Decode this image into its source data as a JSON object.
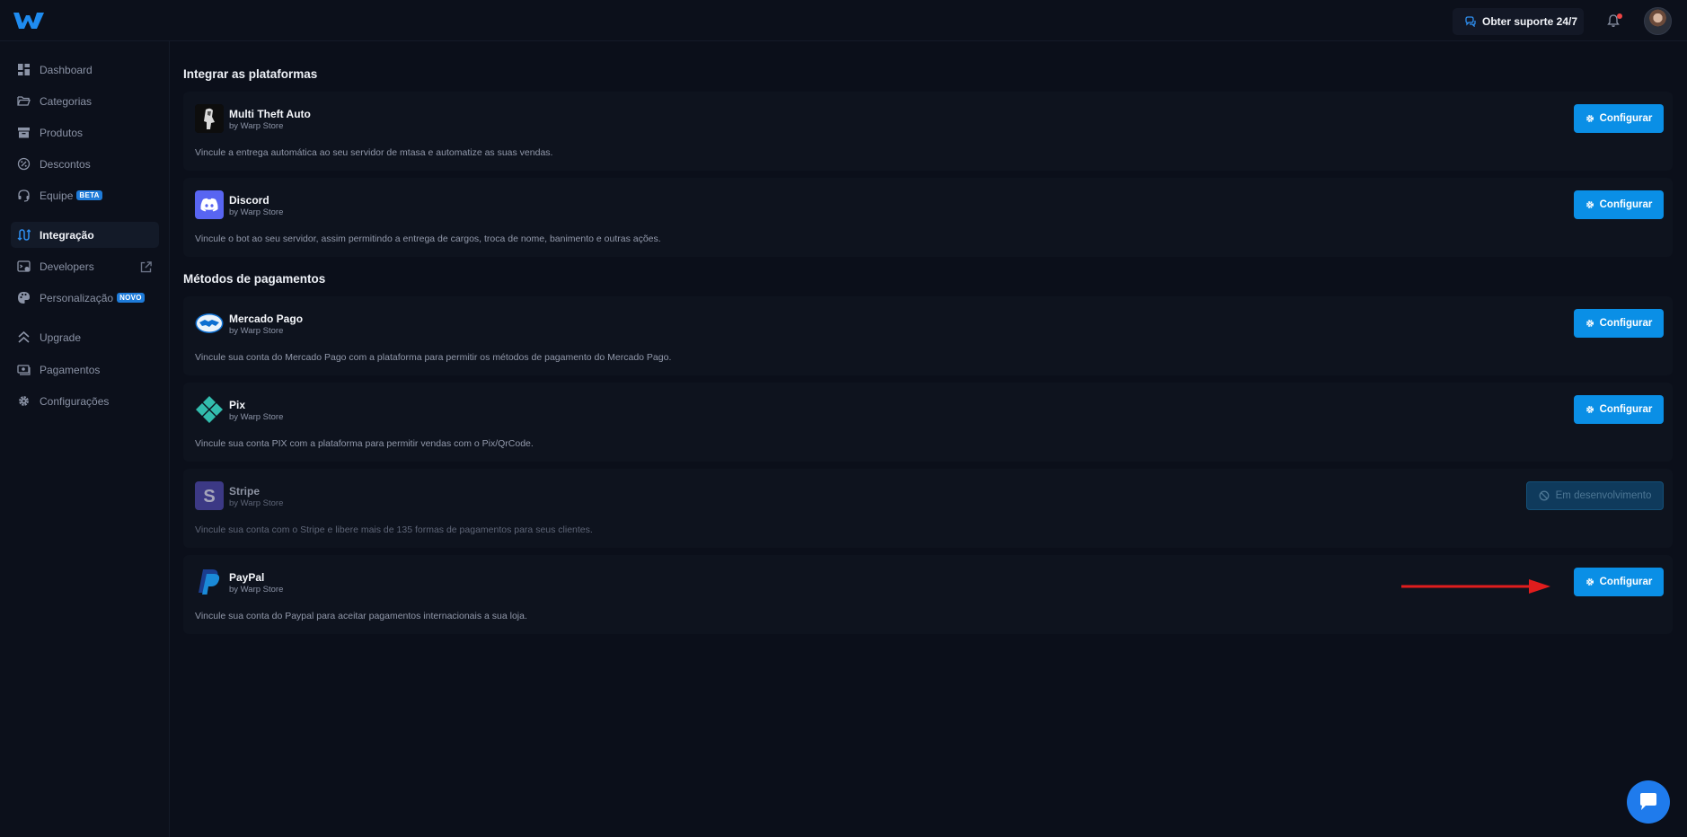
{
  "topbar": {
    "support_label": "Obter suporte 24/7"
  },
  "sidebar": {
    "items": [
      {
        "label": "Dashboard",
        "icon": "dashboard-icon"
      },
      {
        "label": "Categorias",
        "icon": "folder-icon"
      },
      {
        "label": "Produtos",
        "icon": "archive-icon"
      },
      {
        "label": "Descontos",
        "icon": "discount-icon"
      },
      {
        "label": "Equipe",
        "icon": "headset-icon",
        "badge": "BETA"
      },
      {
        "label": "Integração",
        "icon": "integration-icon",
        "active": true
      },
      {
        "label": "Developers",
        "icon": "terminal-icon"
      },
      {
        "label": "Personalização",
        "icon": "palette-icon",
        "badge": "NOVO"
      },
      {
        "label": "Upgrade",
        "icon": "chevrons-up-icon"
      },
      {
        "label": "Pagamentos",
        "icon": "money-icon"
      },
      {
        "label": "Configurações",
        "icon": "gear-icon"
      }
    ]
  },
  "sections": {
    "platforms_title": "Integrar as plataformas",
    "payments_title": "Métodos de pagamentos"
  },
  "integrations": [
    {
      "name": "Multi Theft Auto",
      "by": "by Warp Store",
      "desc": "Vincule a entrega automática ao seu servidor de mtasa e automatize as suas vendas.",
      "button": "Configurar"
    },
    {
      "name": "Discord",
      "by": "by Warp Store",
      "desc": "Vincule o bot ao seu servidor, assim permitindo a entrega de cargos, troca de nome, banimento e outras ações.",
      "button": "Configurar"
    }
  ],
  "payments": [
    {
      "name": "Mercado Pago",
      "by": "by Warp Store",
      "desc": "Vincule sua conta do Mercado Pago com a plataforma para permitir os métodos de pagamento do Mercado Pago.",
      "button": "Configurar"
    },
    {
      "name": "Pix",
      "by": "by Warp Store",
      "desc": "Vincule sua conta PIX com a plataforma para permitir vendas com o Pix/QrCode.",
      "button": "Configurar"
    },
    {
      "name": "Stripe",
      "by": "by Warp Store",
      "desc": "Vincule sua conta com o Stripe e libere mais de 135 formas de pagamentos para seus clientes.",
      "button": "Em desenvolvimento"
    },
    {
      "name": "PayPal",
      "by": "by Warp Store",
      "desc": "Vincule sua conta do Paypal para aceitar pagamentos internacionais a sua loja.",
      "button": "Configurar"
    }
  ],
  "colors": {
    "accent": "#0a8fe6",
    "background": "#0b0f1a",
    "card": "#0e131e",
    "annotation_arrow": "#e11d1d"
  }
}
